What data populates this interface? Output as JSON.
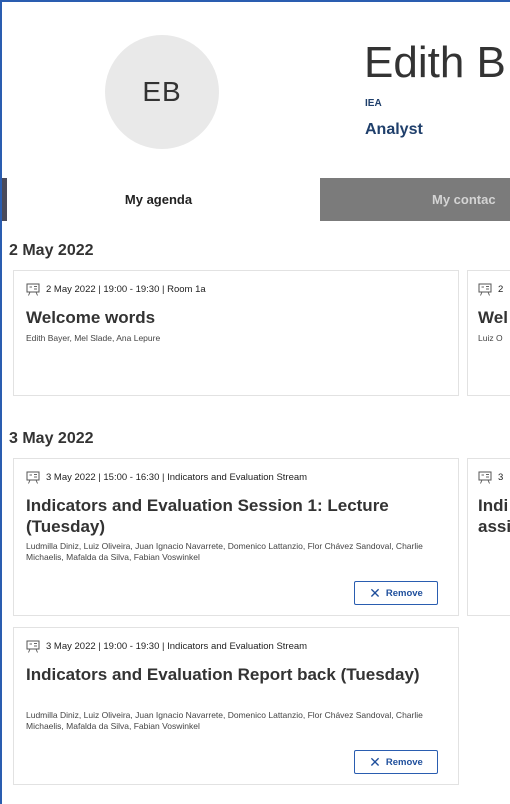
{
  "profile": {
    "initials": "EB",
    "name": "Edith B",
    "organisation": "IEA",
    "role": "Analyst"
  },
  "tabs": {
    "agenda": "My agenda",
    "contacts": "My contac"
  },
  "days": [
    {
      "date": "2 May 2022",
      "sessions": [
        {
          "meta": "2 May 2022 | 19:00 - 19:30 | Room 1a",
          "title": "Welcome words",
          "people": "Edith Bayer, Mel Slade, Ana Lepure"
        },
        {
          "meta": "2",
          "title": "Wel",
          "people": "Luiz O"
        }
      ]
    },
    {
      "date": "3 May 2022",
      "sessions": [
        {
          "meta": "3 May 2022 | 15:00 - 16:30 | Indicators and Evaluation Stream",
          "title": "Indicators and Evaluation  Session 1: Lecture (Tuesday)",
          "people": "Ludmilla Diniz, Luiz Oliveira, Juan Ignacio Navarrete, Domenico Lattanzio, Flor Chávez Sandoval, Charlie Michaelis, Mafalda da Silva, Fabian Voswinkel",
          "action": "Remove"
        },
        {
          "meta": "3",
          "title": "Indi assi"
        },
        {
          "meta": "3 May 2022 | 19:00 - 19:30 | Indicators and Evaluation Stream",
          "title": "Indicators and Evaluation Report back (Tuesday)",
          "people": "Ludmilla Diniz, Luiz Oliveira, Juan Ignacio Navarrete, Domenico Lattanzio, Flor Chávez Sandoval, Charlie Michaelis, Mafalda da Silva, Fabian Voswinkel",
          "action": "Remove"
        }
      ]
    }
  ],
  "icons": {
    "session": "presentation-board-icon",
    "remove": "close-icon"
  },
  "colors": {
    "accent": "#2a5db0",
    "tab_inactive": "#7b7b7b",
    "avatar_bg": "#e9e9e9"
  }
}
